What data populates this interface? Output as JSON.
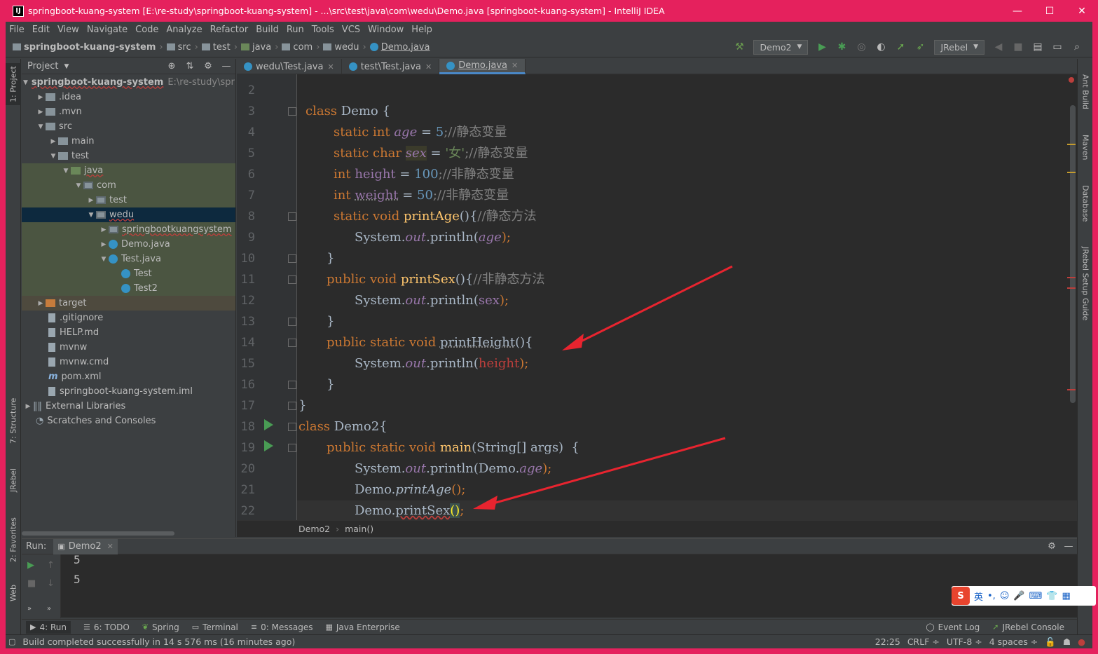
{
  "window": {
    "title": "springboot-kuang-system [E:\\re-study\\springboot-kuang-system] - ...\\src\\test\\java\\com\\wedu\\Demo.java [springboot-kuang-system] - IntelliJ IDEA",
    "app_icon": "IJ",
    "minimize": "—",
    "maximize": "☐",
    "close": "✕",
    "frame_color": "#e5215d"
  },
  "menu": [
    "File",
    "Edit",
    "View",
    "Navigate",
    "Code",
    "Analyze",
    "Refactor",
    "Build",
    "Run",
    "Tools",
    "VCS",
    "Window",
    "Help"
  ],
  "breadcrumbs": [
    "springboot-kuang-system",
    "src",
    "test",
    "java",
    "com",
    "wedu",
    "Demo.java"
  ],
  "run_config": "Demo2",
  "jrebel": "JRebel",
  "left_tabs": [
    "1: Project",
    "7: Structure",
    "JRebel",
    "2: Favorites",
    "Web"
  ],
  "right_tabs": [
    "Ant Build",
    "Maven",
    "Database",
    "JRebel Setup Guide"
  ],
  "project": {
    "header": "Project",
    "root": "springboot-kuang-system",
    "root_path": "E:\\re-study\\spring",
    "items": [
      {
        "label": ".idea"
      },
      {
        "label": ".mvn"
      },
      {
        "label": "src"
      },
      {
        "label": "main"
      },
      {
        "label": "test"
      },
      {
        "label": "java"
      },
      {
        "label": "com"
      },
      {
        "label": "test"
      },
      {
        "label": "wedu"
      },
      {
        "label": "springbootkuangsystem"
      },
      {
        "label": "Demo.java"
      },
      {
        "label": "Test.java"
      },
      {
        "label": "Test"
      },
      {
        "label": "Test2"
      },
      {
        "label": "target"
      },
      {
        "label": ".gitignore"
      },
      {
        "label": "HELP.md"
      },
      {
        "label": "mvnw"
      },
      {
        "label": "mvnw.cmd"
      },
      {
        "label": "pom.xml"
      },
      {
        "label": "springboot-kuang-system.iml"
      },
      {
        "label": "External Libraries"
      },
      {
        "label": "Scratches and Consoles"
      }
    ]
  },
  "editor_tabs": [
    "wedu\\Test.java",
    "test\\Test.java",
    "Demo.java"
  ],
  "line_numbers": [
    "2",
    "3",
    "4",
    "5",
    "6",
    "7",
    "8",
    "9",
    "10",
    "11",
    "12",
    "13",
    "14",
    "15",
    "16",
    "17",
    "18",
    "19",
    "20",
    "21",
    "22"
  ],
  "code": {
    "l3": [
      "class ",
      "Demo",
      " {"
    ],
    "l4": [
      "static int ",
      "age",
      " = ",
      "5",
      ";//静态变量"
    ],
    "l5": [
      "static char ",
      "sex",
      " = ",
      "'女'",
      ";//静态变量"
    ],
    "l6": [
      "int ",
      "height",
      " = ",
      "100",
      ";//非静态变量"
    ],
    "l7": [
      "int ",
      "weight",
      " = ",
      "50",
      ";//非静态变量"
    ],
    "l8": [
      "static void ",
      "printAge",
      "(){",
      "//静态方法"
    ],
    "l9": [
      "System.",
      "out",
      ".println(",
      "age",
      ");"
    ],
    "l10": [
      "}"
    ],
    "l11": [
      "public void ",
      "printSex",
      "(){",
      "//非静态方法"
    ],
    "l12": [
      "System.",
      "out",
      ".println(",
      "sex",
      ");"
    ],
    "l13": [
      "}"
    ],
    "l14": [
      "public static void ",
      "printHeight",
      "(){"
    ],
    "l15": [
      "System.",
      "out",
      ".println(",
      "height",
      ");"
    ],
    "l16": [
      "}"
    ],
    "l17": [
      "}"
    ],
    "l18": [
      "class ",
      "Demo2",
      "{"
    ],
    "l19": [
      "public static void ",
      "main",
      "(String[] args)  {"
    ],
    "l20": [
      "System.",
      "out",
      ".println(Demo.",
      "age",
      ");"
    ],
    "l21": [
      "Demo.",
      "printAge",
      "();"
    ],
    "l22": [
      "Demo.",
      "printSex",
      "()",
      ";"
    ]
  },
  "editor_crumbs": [
    "Demo2",
    "main()"
  ],
  "run": {
    "label": "Run:",
    "tab": "Demo2",
    "output": [
      "5",
      "5"
    ]
  },
  "bottom_tabs": [
    "4: Run",
    "6: TODO",
    "Spring",
    "Terminal",
    "0: Messages",
    "Java Enterprise"
  ],
  "bottom_right": [
    "Event Log",
    "JRebel Console"
  ],
  "status": {
    "message": "Build completed successfully in 14 s 576 ms (16 minutes ago)",
    "position": "22:25",
    "line_sep": "CRLF ÷",
    "encoding": "UTF-8 ÷",
    "indent": "4 spaces ÷"
  },
  "ime": {
    "logo": "S",
    "lang": "英"
  },
  "colors": {
    "keyword": "#cc7832",
    "number": "#6897bb",
    "comment": "#808080",
    "field": "#9876aa",
    "method": "#ffc66d",
    "arrow": "#e8242f"
  }
}
